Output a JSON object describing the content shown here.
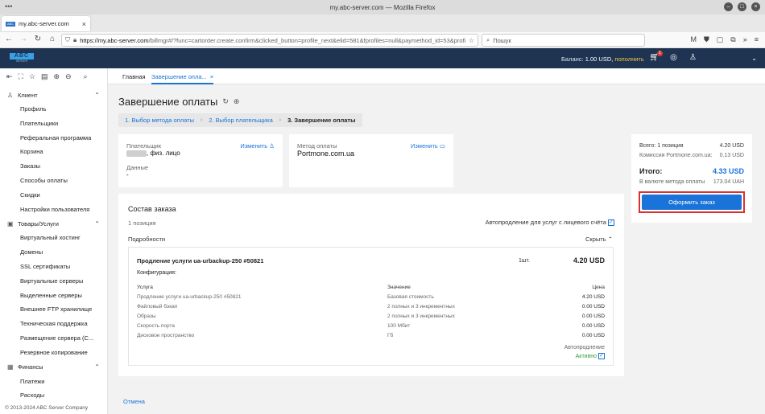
{
  "browser": {
    "window_title": "my.abc-server.com — Mozilla Firefox",
    "tab_title": "my.abc-server.com",
    "url_host": "https://my.abc-server.com",
    "url_rest": "/billmgr#/?func=cartorder.create.confirm&clicked_button=profile_next&elid=581&fprofiles=null&paymethod_id=53&profile",
    "search_placeholder": "Пошук"
  },
  "app": {
    "logo_main": "ABC",
    "logo_sub": "SERVER",
    "balance_label": "Баланс:",
    "balance_value": "1.00 USD,",
    "topup_link": "пополнить",
    "notification_count": "1"
  },
  "sidebar": {
    "sections": [
      {
        "label": "Клиент",
        "icon": "user-icon",
        "items": [
          "Профиль",
          "Плательщики",
          "Реферальная программа",
          "Корзина",
          "Заказы",
          "Способы оплаты",
          "Скидки",
          "Настройки пользователя"
        ]
      },
      {
        "label": "Товары/Услуги",
        "icon": "box-icon",
        "items": [
          "Виртуальный хостинг",
          "Домены",
          "SSL сертификаты",
          "Виртуальные серверы",
          "Выделенные серверы",
          "Внешнее FTP хранилище",
          "Техническая поддержка",
          "Размещение сервера (C...",
          "Резервное копирование"
        ]
      },
      {
        "label": "Финансы",
        "icon": "wallet-icon",
        "items": [
          "Платежи",
          "Расходы"
        ]
      }
    ],
    "copyright": "© 2013-2024 ABC Server Company"
  },
  "content_tabs": {
    "home": "Главная",
    "active": "Завершение опла..."
  },
  "page": {
    "title": "Завершение оплаты",
    "steps": [
      "1. Выбор метода оплаты",
      "2. Выбор плательщика",
      "3. Завершение оплаты"
    ]
  },
  "payer_card": {
    "payer_label": "Плательщик",
    "payer_value": ", физ. лицо",
    "change_label": "Изменить",
    "data_label": "Данные",
    "data_value": "-"
  },
  "method_card": {
    "method_label": "Метод оплаты",
    "method_value": "Portmone.com.ua",
    "change_label": "Изменить"
  },
  "order": {
    "title": "Состав заказа",
    "positions": "1 позиция",
    "autorenew_label": "Автопродление для услуг с лицевого счёта",
    "details_label": "Подробности",
    "hide_label": "Скрыть",
    "item": {
      "name": "Продление услуги ua-urbackup-250 #50821",
      "qty": "1шт.",
      "price": "4.20 USD",
      "config_label": "Конфигурация:",
      "col_service": "Услуга",
      "col_value": "Значение",
      "col_price": "Цена",
      "rows": [
        {
          "service": "Продление услуги ua-urbackup-250 #50821",
          "value": "Базовая стоимость",
          "price": "4.20 USD"
        },
        {
          "service": "Файловый бэкап",
          "value": "2 полных и 3 инкрементных",
          "price": "0.00 USD"
        },
        {
          "service": "Образы",
          "value": "2 полных и 3 инкрементных",
          "price": "0.00 USD"
        },
        {
          "service": "Скорость порта",
          "value": "100 Мбит",
          "price": "0.00 USD"
        },
        {
          "service": "Дисковое пространство",
          "value": "Гб",
          "price": "0.00 USD"
        }
      ],
      "autorenew_label": "Автопродление",
      "autorenew_status": "Активно"
    },
    "cancel_link": "Отмена"
  },
  "summary": {
    "total_positions_label": "Всего: 1 позиция",
    "total_positions_value": "4.20 USD",
    "commission_label": "Комиссия Portmone.com.ua:",
    "commission_value": "0.13 USD",
    "total_label": "Итого:",
    "total_value": "4.33 USD",
    "currency_label": "В валюте метода оплаты",
    "currency_value": "173.04 UAH",
    "order_button": "Оформить заказ"
  },
  "colors": {
    "accent": "#1a73d9",
    "header": "#1f3452",
    "highlight": "#d93030",
    "active_green": "#2e9e3e"
  }
}
